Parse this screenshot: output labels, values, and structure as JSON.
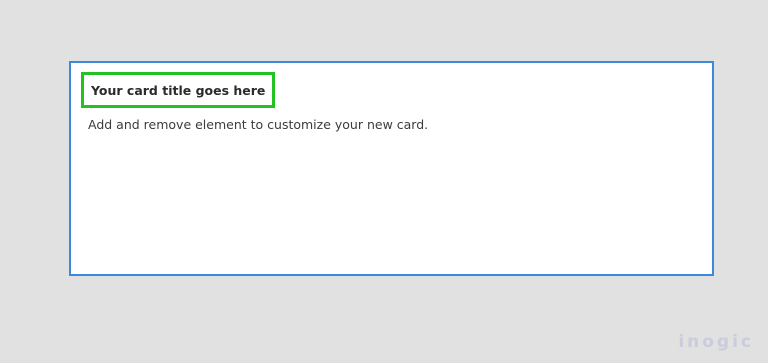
{
  "card": {
    "title": "Your card title goes here",
    "body": "Add and remove element to customize your new card.",
    "border_color": "#3a8ad8",
    "title_highlight_color": "#22c222"
  },
  "watermark": {
    "text": "inogic"
  }
}
